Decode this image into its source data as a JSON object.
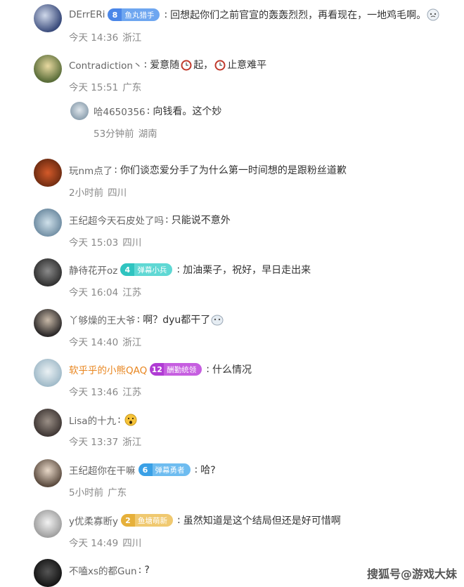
{
  "comments": [
    {
      "user": "DErrERi",
      "badge_level": "8",
      "badge_text": "鱼丸猎手",
      "text": "回想起你们之前官宣的轰轰烈烈，再看现在，一地鸡毛啊。",
      "time": "今天 14:36",
      "location": "浙江"
    },
    {
      "user": "Contradiction丶",
      "text_parts": [
        "爱意随",
        "起，",
        "止意难平"
      ],
      "time": "今天 15:51",
      "location": "广东",
      "reply": {
        "user": "哈4650356",
        "text": "向钱看。这个妙",
        "time": "53分钟前",
        "location": "湖南"
      }
    },
    {
      "user": "玩nm点了",
      "text": "你们谈恋爱分手了为什么第一时间想的是跟粉丝道歉",
      "time": "2小时前",
      "location": "四川"
    },
    {
      "user": "王纪超今天石皮处了吗",
      "text": "只能说不意外",
      "time": "今天 15:03",
      "location": "四川"
    },
    {
      "user": "静待花开oz",
      "badge_level": "4",
      "badge_text": "弹幕小兵",
      "text": "加油栗子，祝好，早日走出来",
      "time": "今天 16:04",
      "location": "江苏"
    },
    {
      "user": "丫够燥的王大爷",
      "text": "啊？dyu都干了",
      "time": "今天 14:40",
      "location": "浙江"
    },
    {
      "user": "软乎乎的小熊QAQ",
      "badge_level": "12",
      "badge_text": "酬勤统领",
      "text": "什么情况",
      "time": "今天 13:46",
      "location": "江苏"
    },
    {
      "user": "Lisa的十九",
      "text": "",
      "time": "今天 13:37",
      "location": "浙江"
    },
    {
      "user": "王纪超你在干嘛",
      "badge_level": "6",
      "badge_text": "弹幕勇者",
      "text": "哈?",
      "time": "5小时前",
      "location": "广东"
    },
    {
      "user": "y优柔寡断y",
      "badge_level": "2",
      "badge_text": "鱼塘萌新",
      "text": "虽然知道是这个结局但还是好可惜啊",
      "time": "今天 14:49",
      "location": "四川"
    },
    {
      "user": "不嗑xs的都Gun",
      "text": "?",
      "time": "",
      "location": ""
    }
  ],
  "watermark": "搜狐号@游戏大妹",
  "colors": {
    "username": "#666666",
    "username_highlight": "#e8851e",
    "meta": "#888888"
  }
}
